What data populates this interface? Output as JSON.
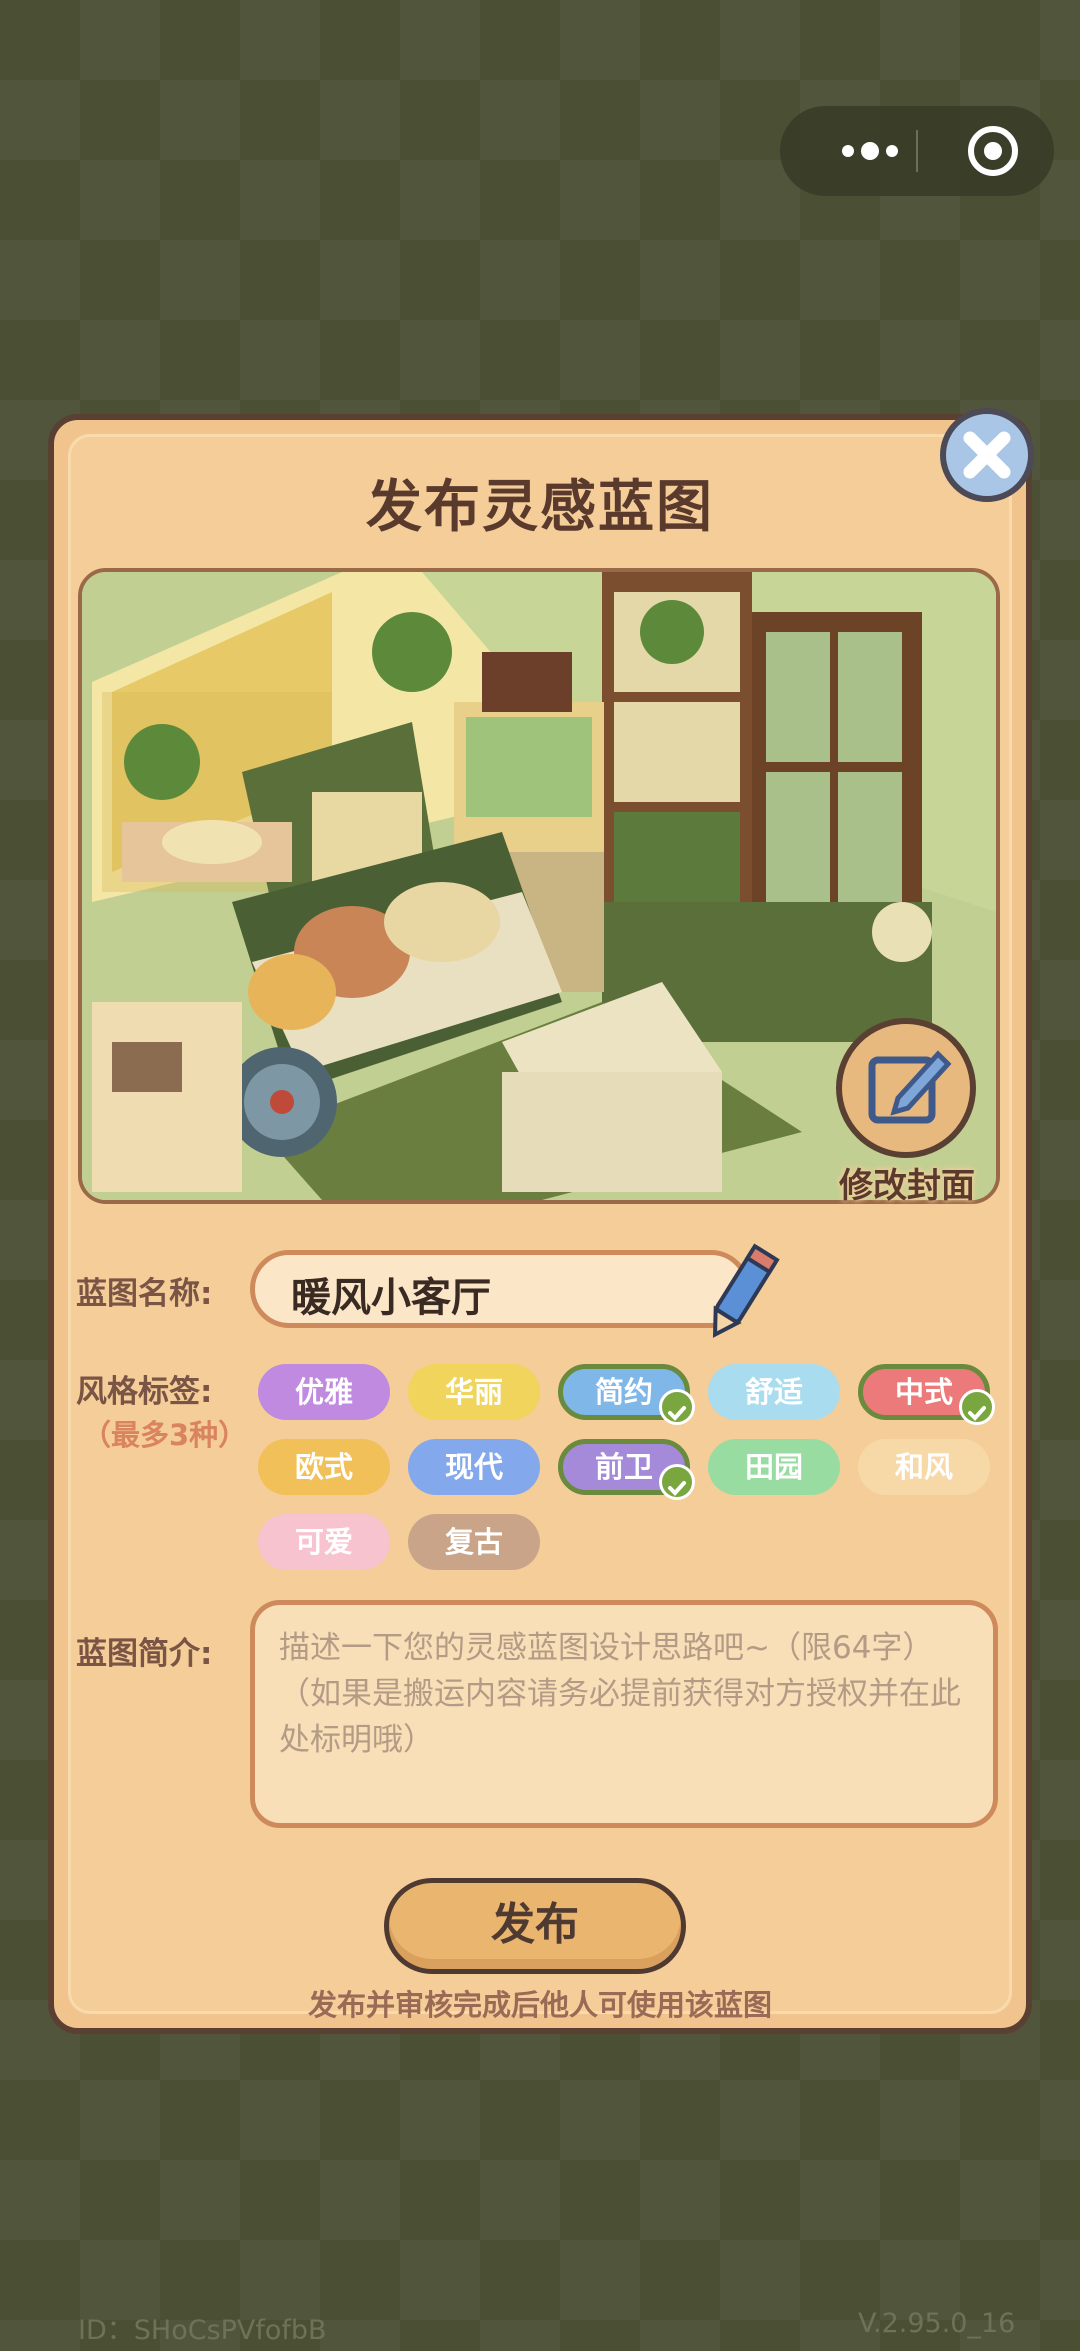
{
  "dialog": {
    "title": "发布灵感蓝图",
    "edit_cover_label": "修改封面",
    "name_label": "蓝图名称:",
    "name_value": "暖风小客厅",
    "style_label": "风格标签:",
    "style_hint": "（最多3种）",
    "description_label": "蓝图简介:",
    "description_placeholder_1": "描述一下您的灵感蓝图设计思路吧~（限64字）",
    "description_placeholder_2": "（如果是搬运内容请务必提前获得对方授权并在此处标明哦）",
    "publish_button": "发布",
    "publish_note": "发布并审核完成后他人可使用该蓝图"
  },
  "tags": [
    {
      "label": "优雅",
      "color": "#c08ae0",
      "selected": false
    },
    {
      "label": "华丽",
      "color": "#f0d45c",
      "selected": false
    },
    {
      "label": "简约",
      "color": "#7fb8e8",
      "selected": true
    },
    {
      "label": "舒适",
      "color": "#a9dcef",
      "selected": false
    },
    {
      "label": "中式",
      "color": "#ec7a7a",
      "selected": true
    },
    {
      "label": "欧式",
      "color": "#f2c058",
      "selected": false
    },
    {
      "label": "现代",
      "color": "#84a8ec",
      "selected": false
    },
    {
      "label": "前卫",
      "color": "#a48ad8",
      "selected": true
    },
    {
      "label": "田园",
      "color": "#98dca2",
      "selected": false
    },
    {
      "label": "和风",
      "color": "#f7d9a7",
      "selected": false
    },
    {
      "label": "可爱",
      "color": "#f7c3cf",
      "selected": false
    },
    {
      "label": "复古",
      "color": "#c9a488",
      "selected": false
    }
  ],
  "footer": {
    "id": "ID：SHoCsPVfofbB",
    "version": "V.2.95.0_16"
  },
  "icons": {
    "more": "more-dots-icon",
    "target": "target-icon",
    "close": "close-icon",
    "edit": "edit-icon",
    "pencil": "pencil-icon",
    "check": "check-icon"
  }
}
